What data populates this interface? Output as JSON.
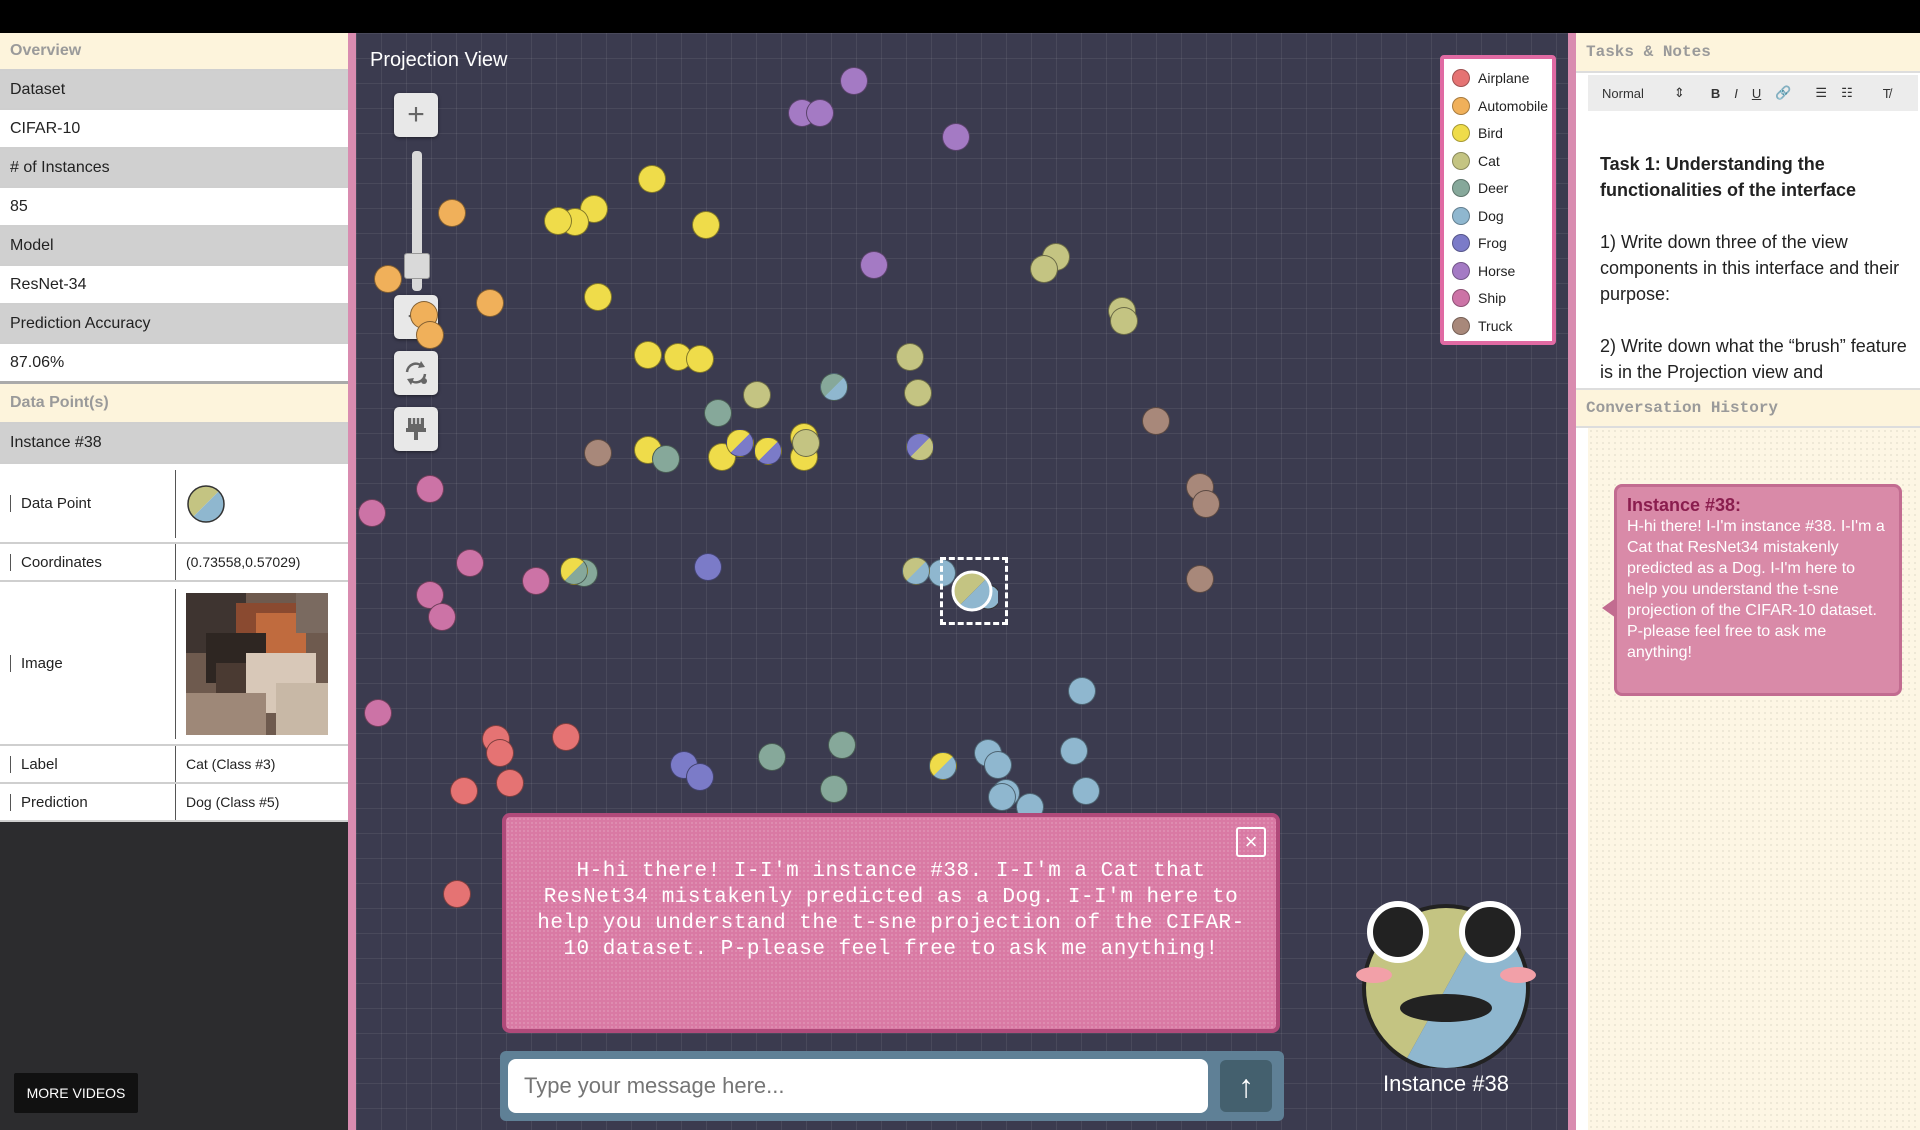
{
  "overview": {
    "section_title": "Overview",
    "dataset_label": "Dataset",
    "dataset_value": "CIFAR-10",
    "instances_label": "# of Instances",
    "instances_value": "85",
    "model_label": "Model",
    "model_value": "ResNet-34",
    "accuracy_label": "Prediction Accuracy",
    "accuracy_value": "87.06%"
  },
  "datapoint": {
    "section_title": "Data Point(s)",
    "instance_title": "Instance #38",
    "point_label": "Data Point",
    "coords_label": "Coordinates",
    "coords_value": "(0.73558,0.57029)",
    "image_label": "Image",
    "label_label": "Label",
    "label_value": "Cat (Class #3)",
    "prediction_label": "Prediction",
    "prediction_value": "Dog (Class #5)"
  },
  "more_videos": "MORE VIDEOS",
  "projection": {
    "title": "Projection View",
    "zoom_in": "+",
    "zoom_out": "−",
    "legend": [
      {
        "name": "Airplane",
        "color": "#e57373"
      },
      {
        "name": "Automobile",
        "color": "#f0b05a"
      },
      {
        "name": "Bird",
        "color": "#efdc4a"
      },
      {
        "name": "Cat",
        "color": "#c4c482"
      },
      {
        "name": "Deer",
        "color": "#86a89a"
      },
      {
        "name": "Dog",
        "color": "#8fb7cf"
      },
      {
        "name": "Frog",
        "color": "#7b7bc8"
      },
      {
        "name": "Horse",
        "color": "#a47ac4"
      },
      {
        "name": "Ship",
        "color": "#cc73a6"
      },
      {
        "name": "Truck",
        "color": "#a8887a"
      }
    ]
  },
  "speech": {
    "text": "H-hi there! I-I'm instance #38. I-I'm a Cat that ResNet34 mistakenly predicted as a Dog. I-I'm here to help you understand the t-sne projection of the CIFAR-10 dataset. P-please feel free to ask me anything!",
    "close": "×"
  },
  "chat": {
    "placeholder": "Type your message here...",
    "send": "↑"
  },
  "avatar": {
    "name": "Instance #38"
  },
  "tasks": {
    "section_title": "Tasks & Notes",
    "toolbar": {
      "format": "Normal",
      "bold": "B",
      "italic": "I",
      "underline": "U"
    },
    "task1_title": "Task 1: Understanding the functionalities of the interface",
    "item1": "1) Write down three of the view components in this interface and their purpose:",
    "item2": "2) Write down what the “brush” feature is in the Projection view and"
  },
  "conversation": {
    "section_title": "Conversation History",
    "sender": "Instance #38:",
    "message": "H-hi there! I-I'm instance #38. I-I'm a Cat that ResNet34 mistakenly predicted as a Dog. I-I'm here to help you understand the t-sne projection of the CIFAR-10 dataset. P-please feel free to ask me anything!"
  }
}
